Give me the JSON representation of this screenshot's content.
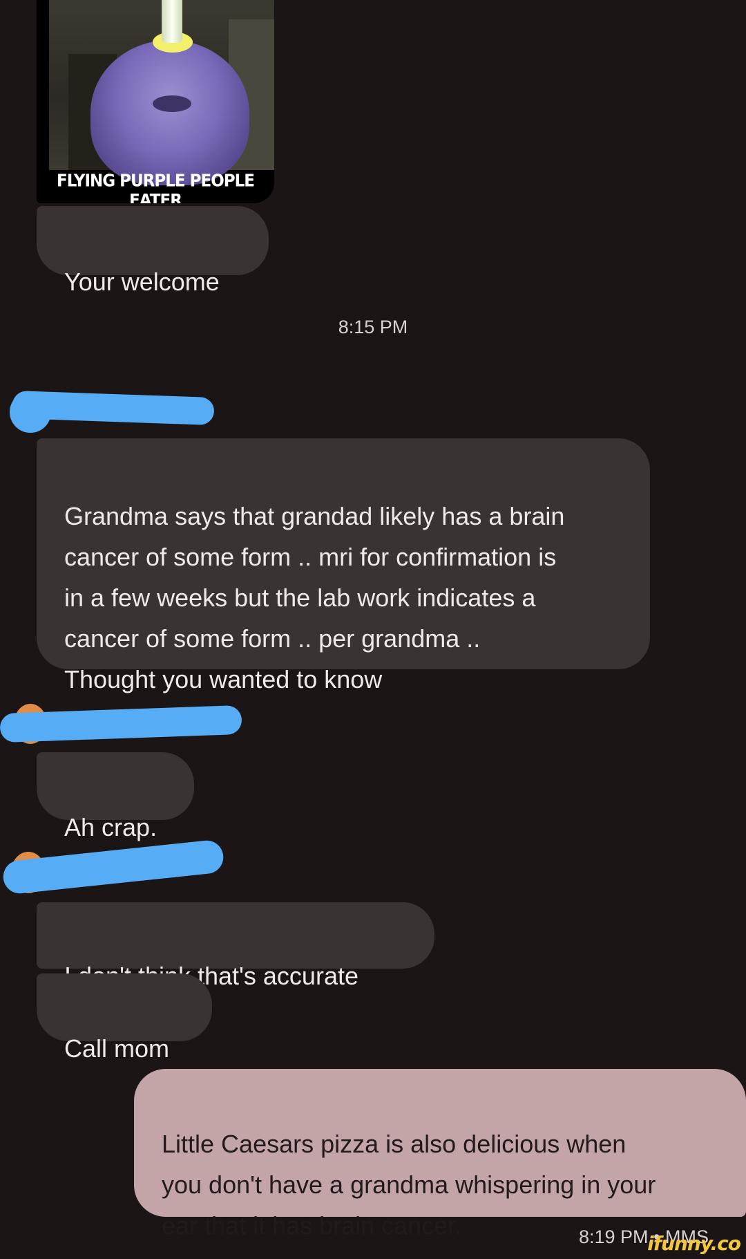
{
  "image_message": {
    "caption": "FLYING PURPLE PEOPLE EATER"
  },
  "messages": {
    "welcome": "Your welcome",
    "timestamp_1": "8:15 PM",
    "grandma": "Grandma says that grandad likely has a brain\ncancer of some form .. mri for confirmation is\nin a few weeks but the lab work indicates a\ncancer of some form .. per grandma ..\nThought you wanted to know",
    "ah_crap": "Ah crap.",
    "not_accurate": "I don't think that's accurate",
    "call_mom": "Call mom",
    "pizza": "Little Caesars pizza is also delicious when\nyou don't have a grandma whispering in your\near that it has brain cancer.",
    "sent_meta": "8:19 PM • MMS"
  },
  "watermark": "ifunny.co",
  "colors": {
    "background": "#1c1516",
    "incoming_bubble": "#3a3334",
    "outgoing_bubble": "#c4a5a7",
    "redaction": "#56adf5"
  }
}
